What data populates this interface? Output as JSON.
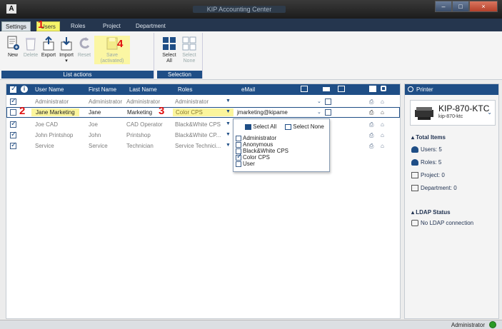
{
  "window": {
    "title": "KIP Accounting Center",
    "app_icon_label": "A",
    "controls": [
      "–",
      "□",
      "×"
    ]
  },
  "tabs": [
    {
      "label": "Settings"
    },
    {
      "label": "Users"
    },
    {
      "label": "Roles"
    },
    {
      "label": "Project"
    },
    {
      "label": "Department"
    }
  ],
  "ribbon": {
    "list_actions": {
      "label": "List actions",
      "buttons": [
        {
          "label": "New",
          "icon": "new-user-icon"
        },
        {
          "label": "Delete",
          "icon": "trash-icon"
        },
        {
          "label": "Export",
          "icon": "export-icon"
        },
        {
          "label": "Import",
          "sub": "▾",
          "icon": "import-icon"
        },
        {
          "label": "Reset",
          "icon": "reset-icon"
        },
        {
          "label": "Save",
          "sub": "(activated)",
          "icon": "save-icon"
        }
      ]
    },
    "selection": {
      "label": "Selection",
      "buttons": [
        {
          "label": "Select",
          "sub": "All",
          "icon": "select-all-icon"
        },
        {
          "label": "Select",
          "sub": "None",
          "icon": "select-none-icon"
        }
      ]
    }
  },
  "grid": {
    "columns": [
      "User Name",
      "First Name",
      "Last Name",
      "Roles",
      "eMail"
    ],
    "rows": [
      {
        "checked": true,
        "user_name": "Administrator",
        "first_name": "Administrator",
        "last_name": "Administrator",
        "roles": "Administrator",
        "email": ""
      },
      {
        "checked": false,
        "user_name": "Jane Marketing",
        "first_name": "Jane",
        "last_name": "Marketing",
        "roles": "Color CPS",
        "email": "jmarketing@kipame"
      },
      {
        "checked": true,
        "user_name": "Joe CAD",
        "first_name": "Joe",
        "last_name": "CAD Operator",
        "roles": "Black&White CPS",
        "email": ""
      },
      {
        "checked": true,
        "user_name": "John Printshop",
        "first_name": "John",
        "last_name": "Printshop",
        "roles": "Black&White CP...",
        "email": ""
      },
      {
        "checked": true,
        "user_name": "Service",
        "first_name": "Service",
        "last_name": "Technician",
        "roles": "Service Technici...",
        "email": ""
      }
    ]
  },
  "roles_dropdown": {
    "select_all": "Select All",
    "select_none": "Select None",
    "options": [
      {
        "label": "Administrator",
        "checked": false
      },
      {
        "label": "Anonymous",
        "checked": false
      },
      {
        "label": "Black&White CPS",
        "checked": false
      },
      {
        "label": "Color CPS",
        "checked": true
      },
      {
        "label": "User",
        "checked": false
      }
    ]
  },
  "markers": [
    "1",
    "2",
    "3",
    "4"
  ],
  "panel": {
    "header": "Printer",
    "printer_name": "KIP-870-KTC",
    "printer_sub": "kip-870-ktc",
    "totals_title": "Total Items",
    "users": "Users: 5",
    "roles": "Roles: 5",
    "project": "Project: 0",
    "department": "Department: 0",
    "ldap_title": "LDAP Status",
    "ldap_status": "No LDAP connection"
  },
  "status": {
    "user": "Administrator",
    "indicator_color": "#2a9a26"
  },
  "colors": {
    "accent": "#1f4e86",
    "highlight": "#fbf59c",
    "marker": "#e01010"
  }
}
